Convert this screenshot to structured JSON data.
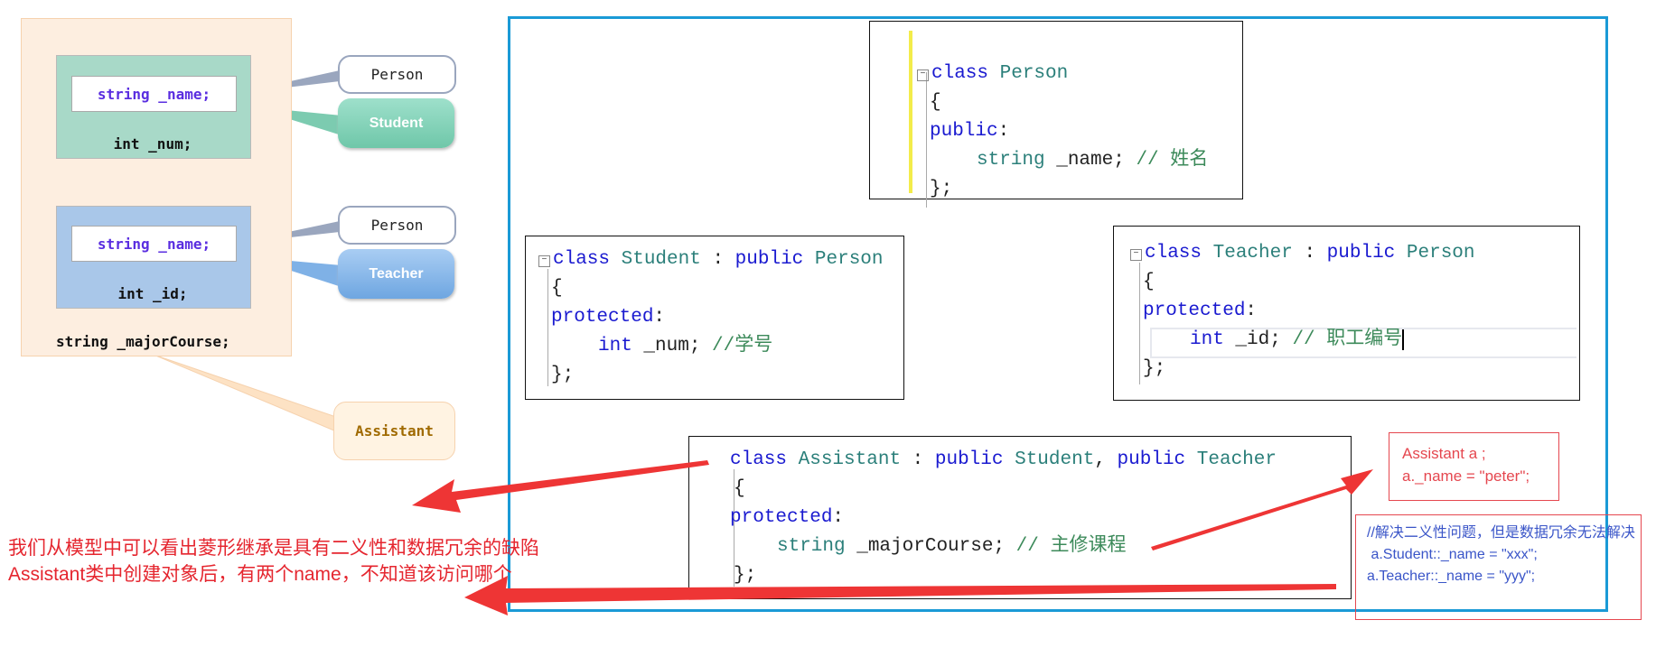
{
  "model": {
    "student_group": {
      "inherited_field": "string _name;",
      "own_field": "int _num;"
    },
    "teacher_group": {
      "inherited_field": "string _name;",
      "own_field": "int _id;"
    },
    "assistant_field": "string _majorCourse;",
    "labels": {
      "person_1": "Person",
      "student": "Student",
      "person_2": "Person",
      "teacher": "Teacher",
      "assistant": "Assistant"
    },
    "colors": {
      "student": "#7ccbb0",
      "teacher": "#7fb1e6",
      "assistant": "#fdeee0",
      "frame": "#1a9ad6",
      "annotation": "#e5262f"
    }
  },
  "code": {
    "person": {
      "l1_kw": "class",
      "l1_name": "Person",
      "l2": "{",
      "l3_kw": "public",
      "l3_rest": ":",
      "l4_type": "string",
      "l4_rest": " _name; ",
      "l4_comment": "// 姓名",
      "l5": "};"
    },
    "student": {
      "l1_kw": "class",
      "l1_name": "Student",
      "l1_sep": " : ",
      "l1_kw2": "public",
      "l1_base": "Person",
      "l2": "{",
      "l3_kw": "protected",
      "l3_rest": ":",
      "l4_type": "int",
      "l4_rest": " _num; ",
      "l4_comment": "//学号",
      "l5": "};"
    },
    "teacher": {
      "l1_kw": "class",
      "l1_name": "Teacher",
      "l1_sep": " : ",
      "l1_kw2": "public",
      "l1_base": "Person",
      "l2": "{",
      "l3_kw": "protected",
      "l3_rest": ":",
      "l4_type": "int",
      "l4_rest": " _id; ",
      "l4_comment": "// 职工编号",
      "l5": "};"
    },
    "assistant": {
      "l1_kw": "class",
      "l1_name": "Assistant",
      "l1_sep": " : ",
      "l1_kw2": "public",
      "l1_base": "Student",
      "l1_comma": ", ",
      "l1_kw3": "public",
      "l1_base2": "Teacher",
      "l2": "{",
      "l3_kw": "protected",
      "l3_rest": ":",
      "l4_type": "string",
      "l4_rest": " _majorCourse; ",
      "l4_comment": "// 主修课程",
      "l5": "};"
    }
  },
  "annotations": {
    "problem_line1": "我们从模型中可以看出菱形继承是具有二义性和数据冗余的缺陷",
    "problem_line2": "Assistant类中创建对象后，有两个name，不知道该访问哪个",
    "ambiguous_line1": "Assistant a ;",
    "ambiguous_line2": "a._name = \"peter\";",
    "fix_line1": "//解决二义性问题，但是数据冗余无法解决",
    "fix_line2": " a.Student::_name = \"xxx\";",
    "fix_line3": "a.Teacher::_name = \"yyy\";"
  }
}
